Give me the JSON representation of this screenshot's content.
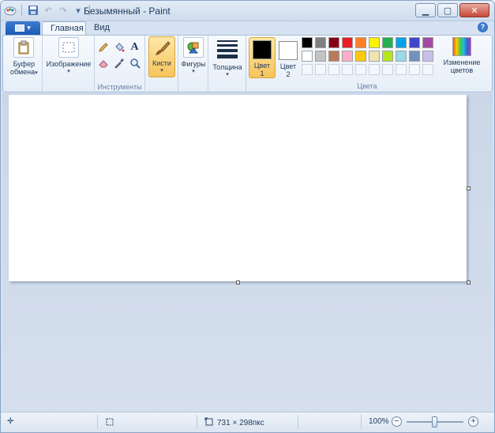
{
  "window": {
    "title": "Безымянный - Paint",
    "controls": {
      "minimize": "▁",
      "maximize": "▢",
      "close": "✕"
    }
  },
  "quick_access": [
    {
      "name": "paint-app-icon",
      "glyph": "🎨"
    },
    {
      "name": "save-icon",
      "glyph": "💾"
    },
    {
      "name": "undo-icon",
      "glyph": "↶"
    },
    {
      "name": "redo-icon",
      "glyph": "↷"
    },
    {
      "name": "customize-qat-icon",
      "glyph": "▾"
    }
  ],
  "tabs": {
    "main": "Главная",
    "view": "Вид",
    "help": "?"
  },
  "ribbon": {
    "clipboard": {
      "label_line1": "Буфер",
      "label_line2": "обмена"
    },
    "image": {
      "label": "Изображение"
    },
    "tools": {
      "group_label": "Инструменты",
      "text_glyph": "A"
    },
    "brushes": {
      "label": "Кисти"
    },
    "shapes": {
      "label": "Фигуры"
    },
    "thickness": {
      "label": "Толщина"
    },
    "color1": {
      "label_line1": "Цвет",
      "label_line2": "1",
      "color": "#000000"
    },
    "color2": {
      "label_line1": "Цвет",
      "label_line2": "2",
      "color": "#ffffff"
    },
    "colors_group_label": "Цвета",
    "edit_colors": {
      "label_line1": "Изменение",
      "label_line2": "цветов"
    }
  },
  "palette": {
    "row1": [
      "#000000",
      "#7f7f7f",
      "#880015",
      "#ed1c24",
      "#ff7f27",
      "#fff200",
      "#22b14c",
      "#00a2e8",
      "#3f48cc",
      "#a349a4"
    ],
    "row2": [
      "#ffffff",
      "#c3c3c3",
      "#b97a57",
      "#ffaec9",
      "#ffc90e",
      "#efe4b0",
      "#b5e61d",
      "#99d9ea",
      "#7092be",
      "#c8bfe7"
    ]
  },
  "statusbar": {
    "canvas_size": "731 × 298пкс",
    "zoom": "100%",
    "zoom_level_fraction": 0.5
  }
}
